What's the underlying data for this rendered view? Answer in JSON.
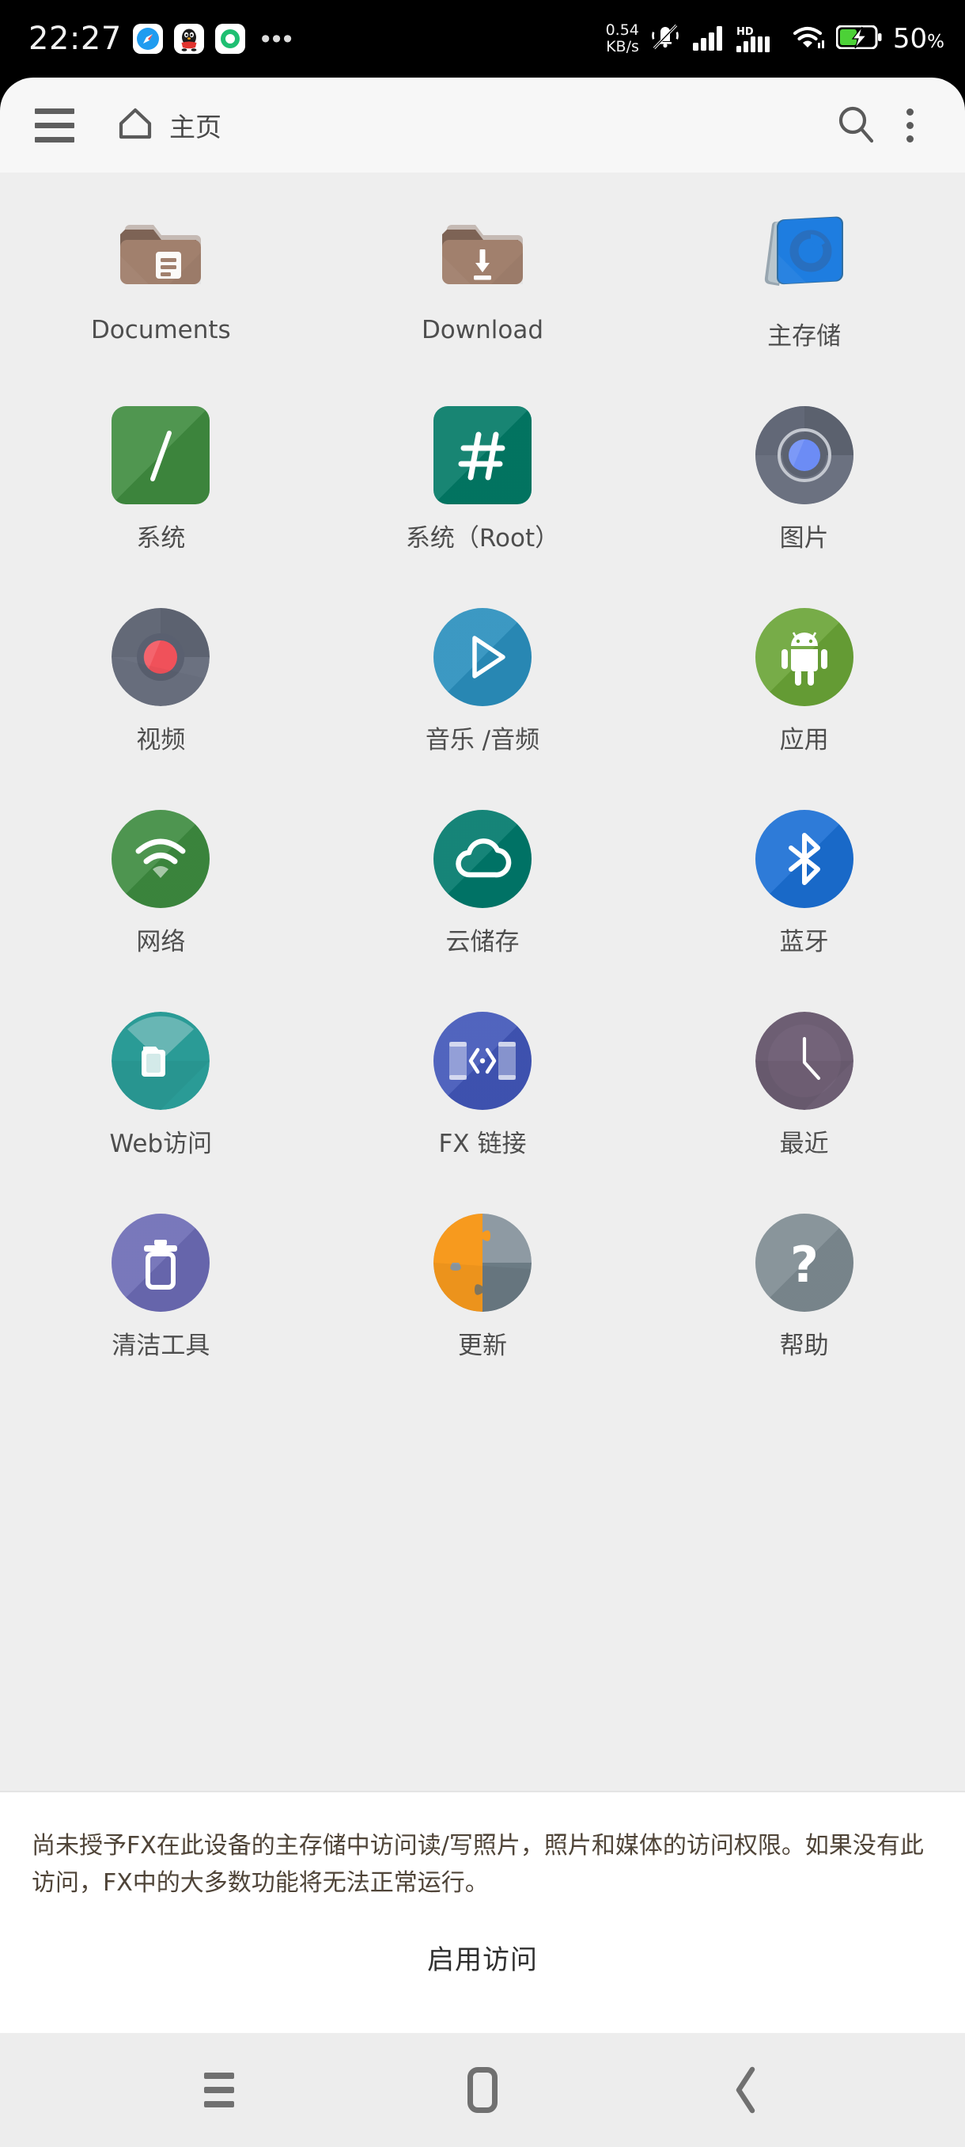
{
  "status_bar": {
    "time": "22:27",
    "notification_icons": [
      "safari-icon",
      "qq-penguin-icon",
      "green-swirl-icon"
    ],
    "more_notifications": "•••",
    "net_speed_value": "0.54",
    "net_speed_unit": "KB/s",
    "silent_icon": "bell-muted-icon",
    "signal_1_icon": "signal-bars-icon",
    "hd_label": "HD",
    "signal_2_icon": "signal-bars-icon",
    "wifi_icon": "wifi-icon",
    "battery_icon": "battery-charging-icon",
    "battery_percent": "50",
    "battery_percent_symbol": "%"
  },
  "app_bar": {
    "menu_icon": "hamburger-menu-icon",
    "home_icon": "home-icon",
    "home_label": "主页",
    "search_icon": "search-icon",
    "overflow_icon": "more-vert-icon"
  },
  "colors": {
    "content_bg": "#eeeeee",
    "app_bar_bg": "#f7f7f7",
    "nav_bar_bg": "#ededed",
    "panel_bg": "#ffffff",
    "permission_text": "#4f4438",
    "folder_brown": "#a1806d",
    "folder_tab_dark": "#7d6355",
    "storage_blue": "#1e7de0",
    "system_green": "#3f8c3f",
    "system_root_teal": "#027a66",
    "images_gray": "#6b7180",
    "images_blue": "#6c8cf5",
    "video_gray": "#6b7180",
    "video_red": "#f0515a",
    "music_blue": "#2a8fbd",
    "apps_green": "#6aa437",
    "network_green": "#3d8b40",
    "cloud_teal": "#00796b",
    "bluetooth_blue": "#1a6fd4",
    "web_teal": "#2a9b96",
    "fx_link_blue": "#4156b8",
    "recent_purple": "#6d5e73",
    "clean_purple": "#6c6bb5",
    "update_orange": "#f79a1e",
    "update_gray": "#8e9aa3",
    "help_gray": "#7e8b92"
  },
  "grid": {
    "items": [
      {
        "label": "Documents",
        "icon": "folder-documents-icon"
      },
      {
        "label": "Download",
        "icon": "folder-download-icon"
      },
      {
        "label": "主存储",
        "icon": "internal-storage-icon"
      },
      {
        "label": "系统",
        "icon": "system-root-slash-icon"
      },
      {
        "label": "系统（Root）",
        "icon": "system-root-hash-icon"
      },
      {
        "label": "图片",
        "icon": "images-icon"
      },
      {
        "label": "视频",
        "icon": "video-icon"
      },
      {
        "label": "音乐 /音频",
        "icon": "music-audio-icon"
      },
      {
        "label": "应用",
        "icon": "apps-android-icon"
      },
      {
        "label": "网络",
        "icon": "network-wifi-icon"
      },
      {
        "label": "云储存",
        "icon": "cloud-storage-icon"
      },
      {
        "label": "蓝牙",
        "icon": "bluetooth-icon"
      },
      {
        "label": "Web访问",
        "icon": "web-access-icon"
      },
      {
        "label": "FX 链接",
        "icon": "fx-connect-icon"
      },
      {
        "label": "最近",
        "icon": "recent-clock-icon"
      },
      {
        "label": "清洁工具",
        "icon": "clean-trash-icon"
      },
      {
        "label": "更新",
        "icon": "update-puzzle-icon"
      },
      {
        "label": "帮助",
        "icon": "help-question-icon"
      }
    ]
  },
  "permission": {
    "message": "尚未授予FX在此设备的主存储中访问读/写照片，照片和媒体的访问权限。如果没有此访问，FX中的大多数功能将无法正常运行。",
    "action_label": "启用访问"
  },
  "nav_bar": {
    "recents_icon": "recents-icon",
    "home_icon": "home-square-icon",
    "back_icon": "back-chevron-icon"
  }
}
